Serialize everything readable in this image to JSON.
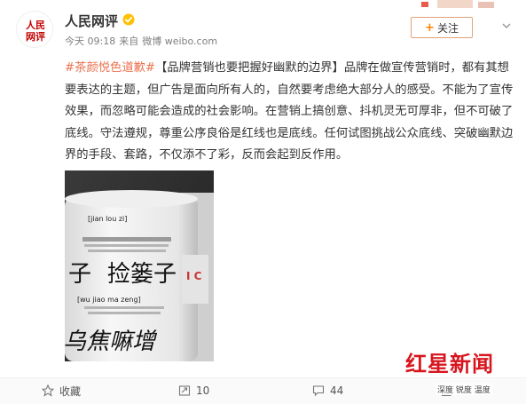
{
  "header": {
    "username": "人民网评",
    "timestamp": "今天 09:18",
    "source_prefix": "来自",
    "source": "微博 weibo.com",
    "follow_label": "关注",
    "avatar_text": "人民网评",
    "verified_icon": "verified-badge-icon",
    "accent_color": "#ff8200"
  },
  "post": {
    "topic": "#茶颜悦色道歉#",
    "body": "【品牌营销也要把握好幽默的边界】品牌在做宣传营销时，都有其想要表达的主题，但广告是面向所有人的，自然要考虑绝大部分人的感受。不能为了宣传效果，而忽略可能会造成的社会影响。在营销上搞创意、抖机灵无可厚非，但不可破了底线。守法遵规，尊重公序良俗是红线也是底线。任何试图挑战公众底线、突破幽默边界的手段、套路，不仅添不了彩，反而会起到反作用。",
    "topic_color": "#eb7350"
  },
  "photo": {
    "label1": "[jian lou zi]",
    "label2": "[wu jiao ma zeng]",
    "big_text1": "捡篓子",
    "big_text2": "乌焦嘛增",
    "side_letter": "子",
    "side_letter2": "I C"
  },
  "watermark": {
    "title": "红星新闻",
    "subtitle": "深度 锐度 温度",
    "color": "#d8161f"
  },
  "footer": {
    "favorite_label": "收藏",
    "forward_count": "10",
    "comment_count": "44",
    "like_count": ""
  }
}
